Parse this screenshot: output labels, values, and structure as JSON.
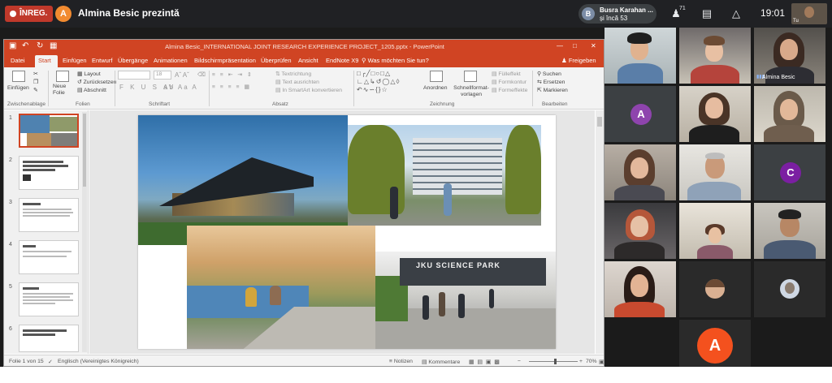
{
  "meeting": {
    "recording_label": "ÎNREG.",
    "presenter_initial": "A",
    "presenter_text": "Almina Besic prezintă",
    "participants_initial": "B",
    "participants_line1": "Busra Karahan ...",
    "participants_line2": "și încă 53",
    "people_count": "71",
    "clock": "19:01",
    "self_label": "Tu"
  },
  "ppt": {
    "window_title": "Almina Besic_INTERNATIONAL JOINT RESEARCH EXPERIENCE PROJECT_1205.pptx  -  PowerPoint",
    "tabs": [
      "Datei",
      "Start",
      "Einfügen",
      "Entwurf",
      "Übergänge",
      "Animationen",
      "Bildschirmpräsentation",
      "Überprüfen",
      "Ansicht",
      "EndNote X9"
    ],
    "tell_me": "Was möchten Sie tun?",
    "share": "Freigeben",
    "ribbon": {
      "paste": "Einfügen",
      "new_slide": "Neue Folie",
      "layout": "Layout",
      "reset": "Zurücksetzen",
      "section": "Abschnitt",
      "font_size": "18",
      "text_direction": "Textrichtung",
      "align_text": "Text ausrichten",
      "smartart": "In SmartArt konvertieren",
      "arrange": "Anordnen",
      "quick_styles": "Schnellformat-vorlagen",
      "fill": "Fülleffekt",
      "outline": "Formkontur",
      "effects": "Formeffekte",
      "find": "Suchen",
      "replace": "Ersetzen",
      "select": "Markieren",
      "groups": [
        "Zwischenablage",
        "Folien",
        "Schriftart",
        "Absatz",
        "Zeichnung",
        "Bearbeiten"
      ]
    },
    "thumbnails": [
      "1",
      "2",
      "3",
      "4",
      "5",
      "6"
    ],
    "slide_sign": "JKU SCIENCE PARK",
    "status": {
      "slide_count": "Folie 1 von 15",
      "language": "Englisch (Vereinigtes Königreich)",
      "notes": "Notizen",
      "comments": "Kommentare",
      "zoom": "70%"
    }
  },
  "gallery": {
    "speaker_name": "Almina Besic",
    "avatar_a": "A",
    "avatar_c": "C",
    "bottom_avatar": "A",
    "colors": {
      "avatar_a": "#8e44ad",
      "avatar_c": "#7b1fa2",
      "bottom_avatar": "#f4511e"
    }
  }
}
